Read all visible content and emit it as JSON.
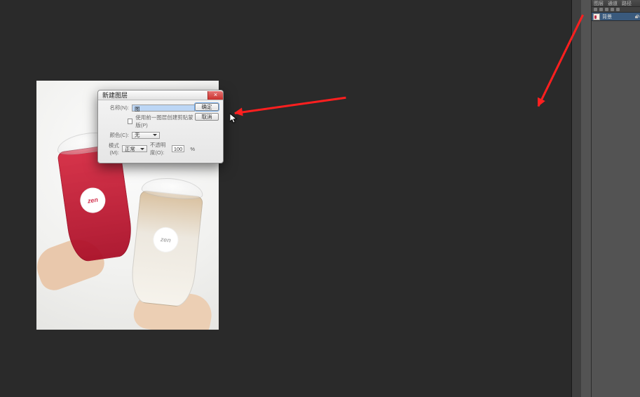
{
  "dialog": {
    "title": "新建图层",
    "name_label": "名称(N):",
    "name_value": "图",
    "clip_checkbox_label": "使用前一图层创建剪贴蒙版(P)",
    "color_label": "颜色(C):",
    "color_value": "无",
    "mode_label": "模式(M):",
    "mode_value": "正常",
    "opacity_label": "不透明度(O):",
    "opacity_value": "100",
    "opacity_unit": "%",
    "ok": "确定",
    "cancel": "取消"
  },
  "layers_panel": {
    "tabs": [
      "图层",
      "通道",
      "路径"
    ],
    "layer_name": "背景"
  },
  "logo_text": "zen"
}
